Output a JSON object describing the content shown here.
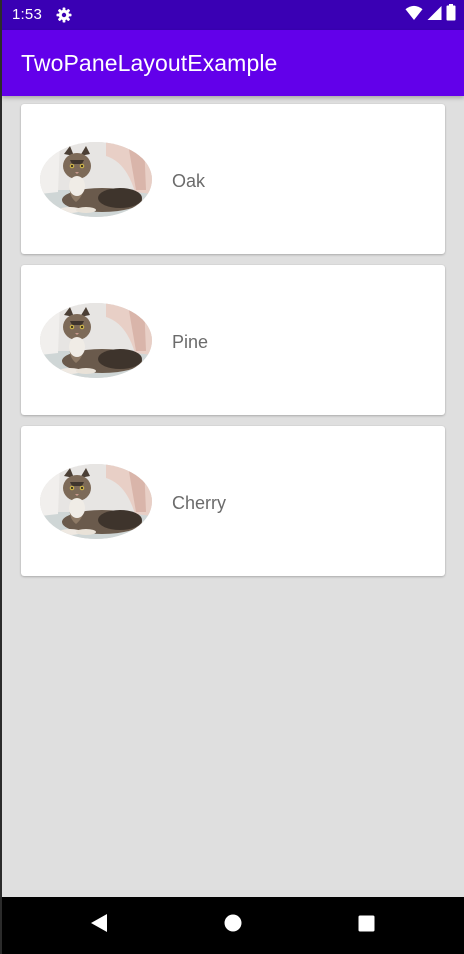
{
  "status_bar": {
    "time": "1:53",
    "icons": [
      "gear-icon",
      "wifi-icon",
      "cell-signal-icon",
      "battery-icon"
    ]
  },
  "app_bar": {
    "title": "TwoPaneLayoutExample"
  },
  "items": [
    {
      "label": "Oak",
      "thumbnail": "cat-photo"
    },
    {
      "label": "Pine",
      "thumbnail": "cat-photo"
    },
    {
      "label": "Cherry",
      "thumbnail": "cat-photo"
    }
  ],
  "nav_bar": {
    "buttons": [
      "back-icon",
      "home-icon",
      "recents-icon"
    ]
  },
  "colors": {
    "status_bar": "#3a00b4",
    "app_bar": "#6200ea",
    "background": "#dfdfdf",
    "card": "#ffffff",
    "label_text": "#6b6b6b"
  }
}
